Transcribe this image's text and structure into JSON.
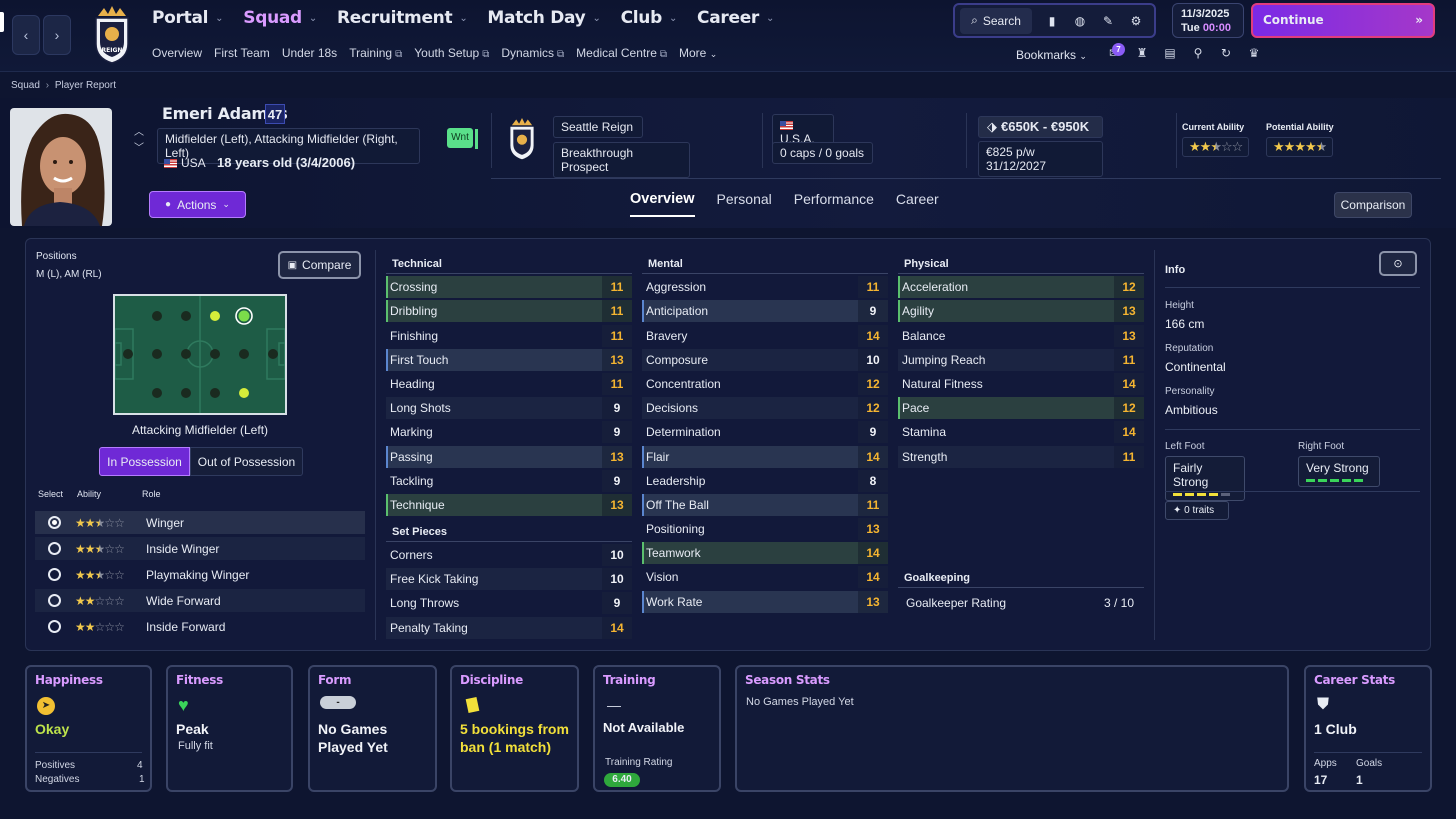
{
  "nav": {
    "back": "‹",
    "forward": "›",
    "main": [
      {
        "label": "Portal",
        "active": false
      },
      {
        "label": "Squad",
        "active": true
      },
      {
        "label": "Recruitment",
        "active": false
      },
      {
        "label": "Match Day",
        "active": false
      },
      {
        "label": "Club",
        "active": false
      },
      {
        "label": "Career",
        "active": false
      }
    ],
    "sub": [
      {
        "label": "Overview",
        "external": false
      },
      {
        "label": "First Team",
        "external": false
      },
      {
        "label": "Under 18s",
        "external": false
      },
      {
        "label": "Training",
        "external": true
      },
      {
        "label": "Youth Setup",
        "external": true
      },
      {
        "label": "Dynamics",
        "external": true
      },
      {
        "label": "Medical Centre",
        "external": true
      },
      {
        "label": "More",
        "external": false
      }
    ],
    "search_label": "Search",
    "date": "11/3/2025",
    "day": "Tue",
    "time": "00:00",
    "continue_label": "Continue",
    "bookmarks_label": "Bookmarks",
    "inbox_count": "7",
    "crest_text": "REIGN"
  },
  "breadcrumb": {
    "parent": "Squad",
    "current": "Player Report"
  },
  "player": {
    "name": "Emeri Adames",
    "ca_number": "47",
    "positions_text": "Midfielder (Left), Attacking Midfielder (Right, Left)",
    "nationality": "USA",
    "age_text": "18 years old (3/4/2006)",
    "tag": "Wnt",
    "club": "Seattle Reign",
    "status": "Breakthrough Prospect",
    "nation": "U.S.A.",
    "caps": "0 caps / 0 goals",
    "value": "€650K - €950K",
    "wage": "€825 p/w 31/12/2027",
    "current_ability_label": "Current Ability",
    "potential_ability_label": "Potential Ability",
    "current_ability_stars": 2.5,
    "potential_ability_stars": 4.5
  },
  "actions_label": "Actions",
  "tabs": [
    {
      "label": "Overview",
      "active": true
    },
    {
      "label": "Personal",
      "active": false
    },
    {
      "label": "Performance",
      "active": false
    },
    {
      "label": "Career",
      "active": false
    }
  ],
  "comparison_label": "Comparison",
  "positions": {
    "label": "Positions",
    "value": "M (L), AM (RL)",
    "compare_label": "Compare",
    "role_title": "Attacking Midfielder (Left)",
    "in_possession": "In Possession",
    "out_possession": "Out of Possession",
    "col_select": "Select",
    "col_ability": "Ability",
    "col_role": "Role",
    "roles": [
      {
        "name": "Winger",
        "stars": 2.5,
        "selected": true
      },
      {
        "name": "Inside Winger",
        "stars": 2.5,
        "selected": false
      },
      {
        "name": "Playmaking Winger",
        "stars": 2.5,
        "selected": false
      },
      {
        "name": "Wide Forward",
        "stars": 2,
        "selected": false
      },
      {
        "name": "Inside Forward",
        "stars": 2,
        "selected": false
      }
    ]
  },
  "technical": {
    "title": "Technical",
    "rows": [
      {
        "name": "Crossing",
        "value": "11",
        "hl": "g"
      },
      {
        "name": "Dribbling",
        "value": "11",
        "hl": "g"
      },
      {
        "name": "Finishing",
        "value": "11",
        "hl": ""
      },
      {
        "name": "First Touch",
        "value": "13",
        "hl": "b"
      },
      {
        "name": "Heading",
        "value": "11",
        "hl": ""
      },
      {
        "name": "Long Shots",
        "value": "9",
        "hl": ""
      },
      {
        "name": "Marking",
        "value": "9",
        "hl": ""
      },
      {
        "name": "Passing",
        "value": "13",
        "hl": "b"
      },
      {
        "name": "Tackling",
        "value": "9",
        "hl": ""
      },
      {
        "name": "Technique",
        "value": "13",
        "hl": "g"
      }
    ]
  },
  "setpieces": {
    "title": "Set Pieces",
    "rows": [
      {
        "name": "Corners",
        "value": "10",
        "hl": ""
      },
      {
        "name": "Free Kick Taking",
        "value": "10",
        "hl": ""
      },
      {
        "name": "Long Throws",
        "value": "9",
        "hl": ""
      },
      {
        "name": "Penalty Taking",
        "value": "14",
        "hl": ""
      }
    ]
  },
  "mental": {
    "title": "Mental",
    "rows": [
      {
        "name": "Aggression",
        "value": "11",
        "hl": ""
      },
      {
        "name": "Anticipation",
        "value": "9",
        "hl": "b"
      },
      {
        "name": "Bravery",
        "value": "14",
        "hl": ""
      },
      {
        "name": "Composure",
        "value": "10",
        "hl": ""
      },
      {
        "name": "Concentration",
        "value": "12",
        "hl": ""
      },
      {
        "name": "Decisions",
        "value": "12",
        "hl": ""
      },
      {
        "name": "Determination",
        "value": "9",
        "hl": ""
      },
      {
        "name": "Flair",
        "value": "14",
        "hl": "b"
      },
      {
        "name": "Leadership",
        "value": "8",
        "hl": ""
      },
      {
        "name": "Off The Ball",
        "value": "11",
        "hl": "b"
      },
      {
        "name": "Positioning",
        "value": "13",
        "hl": ""
      },
      {
        "name": "Teamwork",
        "value": "14",
        "hl": "g"
      },
      {
        "name": "Vision",
        "value": "14",
        "hl": ""
      },
      {
        "name": "Work Rate",
        "value": "13",
        "hl": "b"
      }
    ]
  },
  "physical": {
    "title": "Physical",
    "rows": [
      {
        "name": "Acceleration",
        "value": "12",
        "hl": "g"
      },
      {
        "name": "Agility",
        "value": "13",
        "hl": "g"
      },
      {
        "name": "Balance",
        "value": "13",
        "hl": ""
      },
      {
        "name": "Jumping Reach",
        "value": "11",
        "hl": ""
      },
      {
        "name": "Natural Fitness",
        "value": "14",
        "hl": ""
      },
      {
        "name": "Pace",
        "value": "12",
        "hl": "g"
      },
      {
        "name": "Stamina",
        "value": "14",
        "hl": ""
      },
      {
        "name": "Strength",
        "value": "11",
        "hl": ""
      }
    ]
  },
  "goalkeeping": {
    "title": "Goalkeeping",
    "rating_label": "Goalkeeper Rating",
    "rating_value": "3 / 10"
  },
  "info": {
    "title": "Info",
    "height_label": "Height",
    "height": "166 cm",
    "reputation_label": "Reputation",
    "reputation": "Continental",
    "personality_label": "Personality",
    "personality": "Ambitious",
    "left_foot_label": "Left Foot",
    "left_foot": "Fairly Strong",
    "left_foot_level": 4,
    "right_foot_label": "Right Foot",
    "right_foot": "Very Strong",
    "right_foot_level": 5,
    "traits": "0 traits"
  },
  "cards": {
    "happiness": {
      "title": "Happiness",
      "value": "Okay",
      "positives_label": "Positives",
      "positives": "4",
      "negatives_label": "Negatives",
      "negatives": "1"
    },
    "fitness": {
      "title": "Fitness",
      "value": "Peak",
      "sub": "Fully fit"
    },
    "form": {
      "title": "Form",
      "pill": "-",
      "value": "No Games Played Yet"
    },
    "discipline": {
      "title": "Discipline",
      "value": "5 bookings from ban (1 match)"
    },
    "training": {
      "title": "Training",
      "dash": "—",
      "value": "Not Available",
      "rating_label": "Training Rating",
      "rating": "6.40"
    },
    "season": {
      "title": "Season Stats",
      "value": "No Games Played Yet"
    },
    "career": {
      "title": "Career Stats",
      "value": "1 Club",
      "apps_label": "Apps",
      "apps": "17",
      "goals_label": "Goals",
      "goals": "1"
    }
  },
  "colors": {
    "accent": "#d99bff",
    "highlight_green": "#5bbf6e",
    "highlight_blue": "#5b86cf",
    "value_yellow": "#f5b531"
  }
}
